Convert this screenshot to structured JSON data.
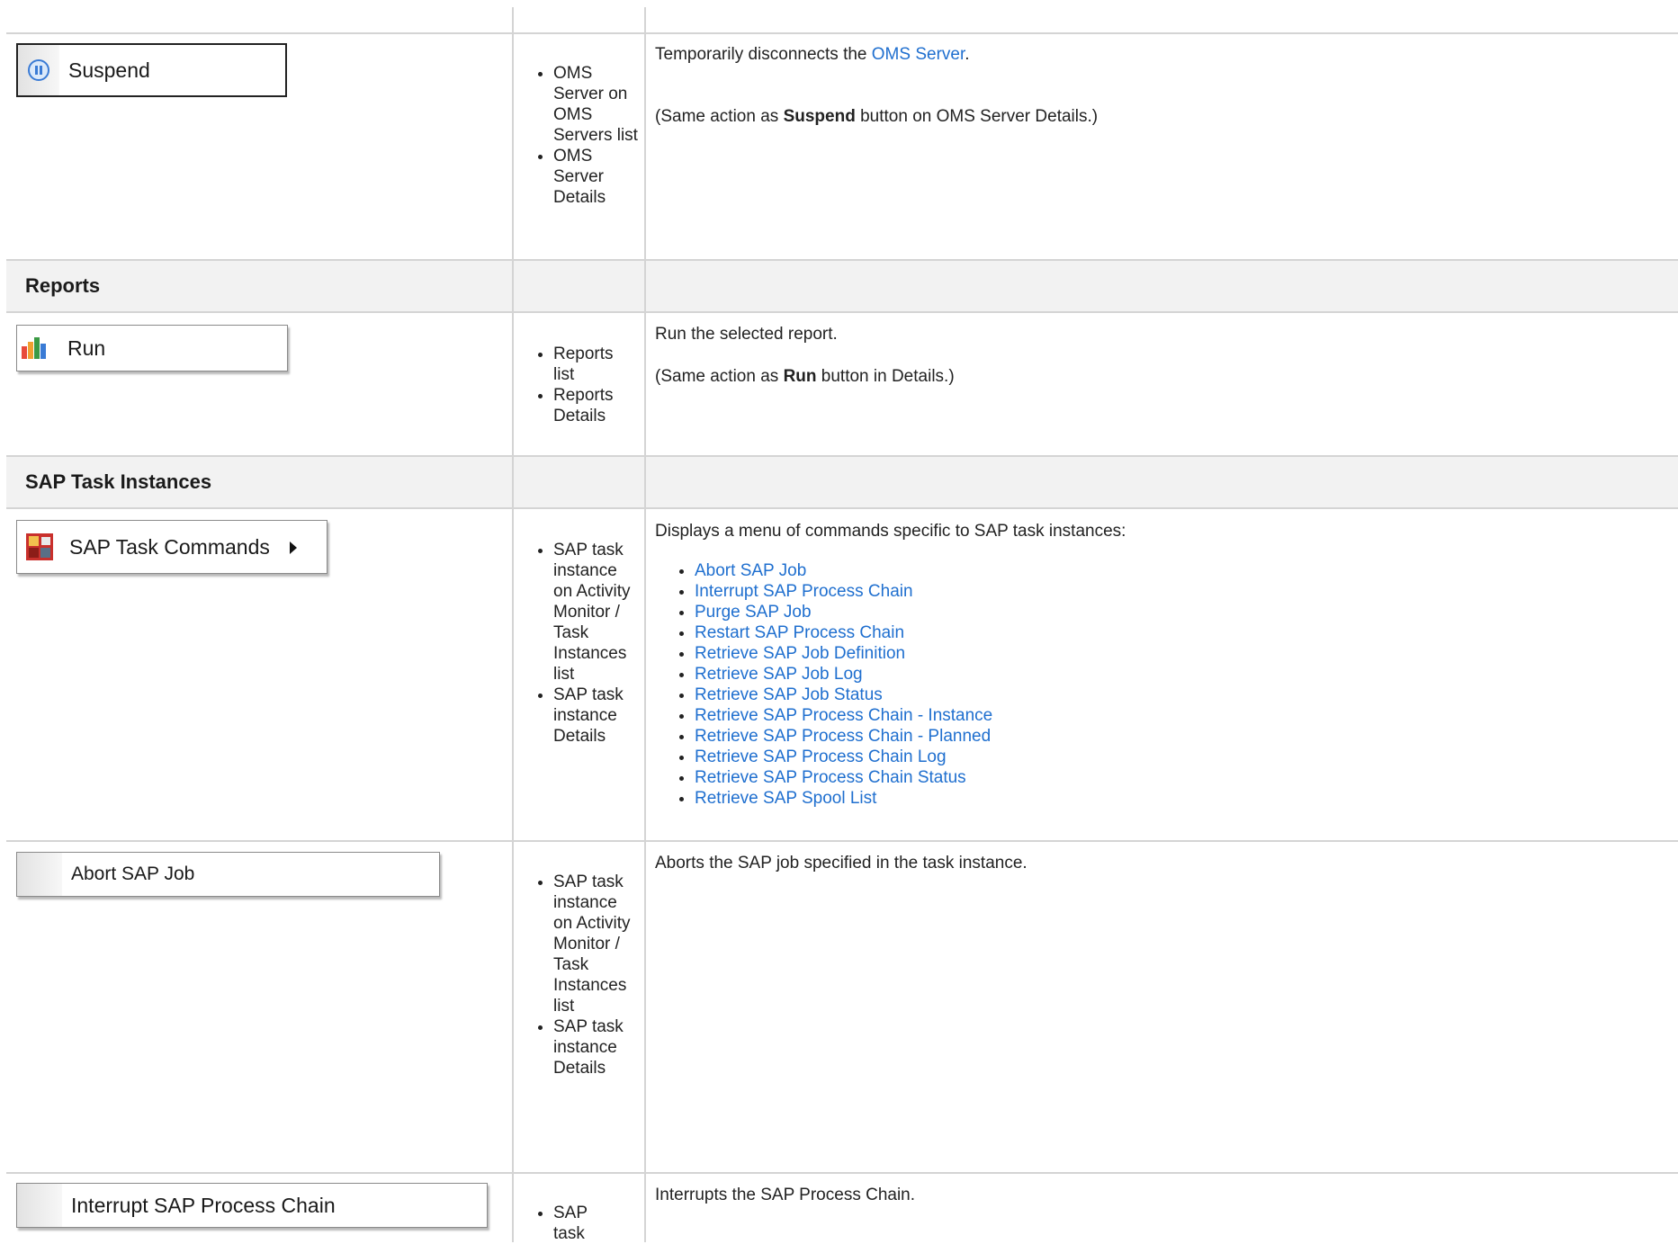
{
  "rows": {
    "suspend": {
      "button_label": "Suspend",
      "where": [
        "OMS Server on OMS Servers list",
        "OMS Server Details"
      ],
      "desc_lead": "Temporarily disconnects the ",
      "desc_link": "OMS Server",
      "desc_end": ".",
      "note_lead": "(Same action as ",
      "note_bold": "Suspend",
      "note_end": " button on OMS Server Details.)"
    },
    "reports_header": "Reports",
    "run": {
      "button_label": "Run",
      "where": [
        "Reports list",
        "Reports Details"
      ],
      "desc": "Run the selected report.",
      "note_lead": "(Same action as ",
      "note_bold": "Run",
      "note_end": " button in Details.)"
    },
    "sap_header": "SAP Task Instances",
    "sap_commands": {
      "button_label": "SAP Task Commands",
      "where": [
        "SAP task instance on Activity Monitor / Task Instances list",
        "SAP task instance Details"
      ],
      "desc": "Displays a menu of commands specific to SAP task instances:",
      "links": [
        "Abort SAP Job",
        "Interrupt SAP Process Chain",
        "Purge SAP Job",
        "Restart SAP Process Chain",
        "Retrieve SAP Job Definition",
        "Retrieve SAP Job Log",
        "Retrieve SAP Job Status",
        "Retrieve SAP Process Chain - Instance",
        "Retrieve SAP Process Chain - Planned",
        "Retrieve SAP Process Chain Log",
        "Retrieve SAP Process Chain Status",
        "Retrieve SAP Spool List"
      ]
    },
    "abort": {
      "button_label": "Abort SAP Job",
      "where": [
        "SAP task instance on Activity Monitor / Task Instances list",
        "SAP task instance Details"
      ],
      "desc": "Aborts the SAP job specified in the task instance."
    },
    "interrupt": {
      "button_label": "Interrupt SAP Process Chain",
      "where": [
        "SAP task"
      ],
      "desc": "Interrupts the SAP Process Chain."
    }
  },
  "icons": {
    "suspend": "pause-circle-icon",
    "run": "bar-chart-icon",
    "sap": "sap-task-icon",
    "submenu": "triangle-right-icon"
  },
  "colors": {
    "link": "#1f6fcf",
    "border": "#d4d4d4",
    "header_bg": "#f2f2f2"
  }
}
